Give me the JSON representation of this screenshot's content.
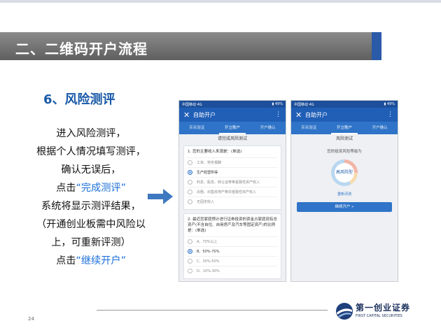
{
  "slide": {
    "title": "二、二维码开户流程",
    "section_heading": "6、风险测评",
    "instructions": [
      [
        {
          "t": "进入风险测评，",
          "h": false
        }
      ],
      [
        {
          "t": "根据个人情况填写测评，",
          "h": false
        }
      ],
      [
        {
          "t": "确认无误后，",
          "h": false
        }
      ],
      [
        {
          "t": "点击",
          "h": false
        },
        {
          "t": "“完成测评”",
          "h": true
        }
      ],
      [
        {
          "t": "系统将显示测评结果，",
          "h": false
        }
      ],
      [
        {
          "t": "（开通创业板需中风险以",
          "h": false
        }
      ],
      [
        {
          "t": "上，可重新评测）",
          "h": false
        }
      ],
      [
        {
          "t": "点击",
          "h": false
        },
        {
          "t": "“继续开户”",
          "h": true
        }
      ]
    ],
    "page_number": "24"
  },
  "logo": {
    "name_cn": "第一创业证券",
    "name_en": "FIRST CAPITAL SECURITIES"
  },
  "phone_common": {
    "status_left": "中国移动 4G",
    "status_right": "▮ 49%",
    "header_title": "自助开户",
    "close_icon_glyph": "✕",
    "menu_icon_glyph": "⋮",
    "tabs": [
      "实名验证",
      "开立账户",
      "开户确认"
    ]
  },
  "phone_left": {
    "subtitle": "请完成风险测试",
    "q1": {
      "text": "1. 您的主要收入来源是：(单选)",
      "options": [
        "工资、劳务报酬",
        "生产经营所得",
        "利息、股息、转让证券等金融性资产收入",
        "出租、出售房地产等非金融性资产收入",
        "无固定收入"
      ],
      "selected": 1
    },
    "q2": {
      "text": "2. 最近您家庭预计进行证券投资的资金占家庭现有总资产(不含自住、自用房产及汽车等固定资产)的比例是：(单选)",
      "options": [
        "A、70%以上",
        "B、50%-70%",
        "C、30%-50%",
        "D、10%-30%"
      ],
      "selected": 1
    }
  },
  "phone_right": {
    "subtitle": "风险测试",
    "result_label": "您的投资风险等级为",
    "result_value": "高风险型",
    "retest_link": "重新评测",
    "continue_button": "继续开户 »"
  },
  "colors": {
    "title_accent": "#2a5aa8",
    "heading": "#1a5aa8",
    "highlight": "#1a6fd8",
    "app_header": "#215fb7",
    "app_tabs": "#2f74c8",
    "arrow": "#3e78c0"
  }
}
